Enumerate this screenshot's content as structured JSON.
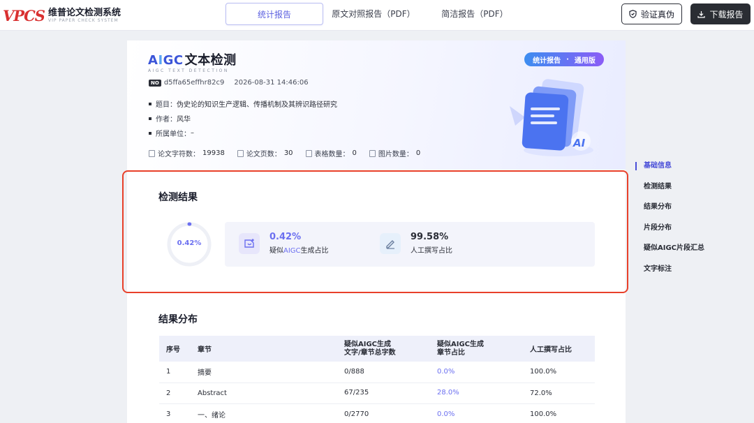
{
  "header": {
    "logo_mark": "VPCS",
    "logo_title": "维普论文检测系统",
    "logo_subtitle": "VIP PAPER CHECK SYSTEM",
    "tabs": [
      {
        "label": "统计报告",
        "active": true
      },
      {
        "label": "原文对照报告（PDF）",
        "active": false
      },
      {
        "label": "简洁报告（PDF）",
        "active": false
      }
    ],
    "verify_label": "验证真伪",
    "download_label": "下载报告"
  },
  "report": {
    "logo_letters": {
      "a": "A",
      "i": "I",
      "gc": "GC"
    },
    "logo_cn": "文本检测",
    "logo_sub": "AIGC TEXT DETECTION",
    "badge_left": "统计报告",
    "badge_sep": "·",
    "badge_right": "通用版",
    "no_tag": "NO",
    "number": "d5ffa65effhr82c9",
    "time": "2026-08-31 14:46:06",
    "meta": [
      {
        "label": "题目：",
        "value": "伪史论的知识生产逻辑、传播机制及其辨识路径研究"
      },
      {
        "label": "作者：",
        "value": "风华"
      },
      {
        "label": "所属单位：",
        "value": "–"
      }
    ],
    "stats": [
      {
        "label": "论文字符数：",
        "value": "19938"
      },
      {
        "label": "论文页数：",
        "value": "30"
      },
      {
        "label": "表格数量：",
        "value": "0"
      },
      {
        "label": "图片数量：",
        "value": "0"
      }
    ],
    "hero_art_text": "AI"
  },
  "results": {
    "title": "检测结果",
    "ring_value": "0.42%",
    "ring_fraction": 0.0042,
    "aigc_value": "0.42%",
    "aigc_label_pre": "疑似",
    "aigc_label_hl": "AIGC",
    "aigc_label_post": "生成占比",
    "human_value": "99.58%",
    "human_label": "人工撰写占比",
    "colors": {
      "aigc": "#6b6ff0",
      "human": "#2a2d36",
      "highlight": "#e8402a"
    }
  },
  "sidenav": [
    {
      "label": "基础信息",
      "active": true
    },
    {
      "label": "检测结果",
      "active": false
    },
    {
      "label": "结果分布",
      "active": false
    },
    {
      "label": "片段分布",
      "active": false
    },
    {
      "label": "疑似AIGC片段汇总",
      "active": false
    },
    {
      "label": "文字标注",
      "active": false
    }
  ],
  "distribution": {
    "title": "结果分布",
    "headers": [
      "序号",
      "章节",
      "疑似AIGC生成\n文字/章节总字数",
      "疑似AIGC生成\n章节占比",
      "人工撰写占比"
    ],
    "rows": [
      [
        "1",
        "摘要",
        "0/888",
        "0.0%",
        "100.0%"
      ],
      [
        "2",
        "Abstract",
        "67/235",
        "28.0%",
        "72.0%"
      ],
      [
        "3",
        "一、绪论",
        "0/2770",
        "0.0%",
        "100.0%"
      ]
    ]
  }
}
